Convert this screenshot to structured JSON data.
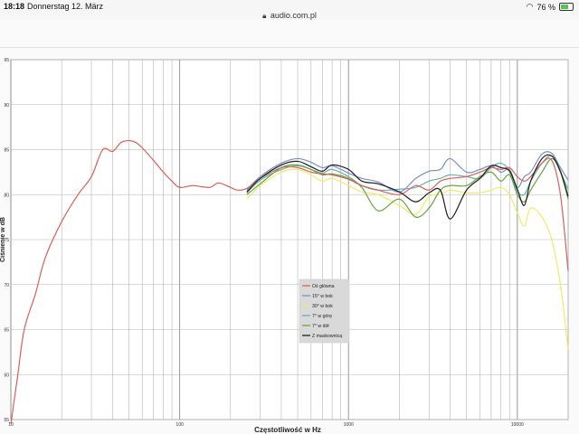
{
  "status_bar": {
    "time": "18:18",
    "date": "Donnerstag 12. März",
    "url": "audio.com.pl",
    "battery": "76 %"
  },
  "icons": [
    "lock-icon",
    "wifi-icon",
    "battery-icon"
  ],
  "chart_data": {
    "type": "line",
    "x_scale": "log",
    "xlim": [
      10,
      20000
    ],
    "ylim": [
      55,
      95
    ],
    "xlabel": "Częstotliwość w Hz",
    "ylabel": "Ciśnienie w dB",
    "x_ticks": [
      {
        "value": 10,
        "label": "10"
      },
      {
        "value": 100,
        "label": "100"
      },
      {
        "value": 1000,
        "label": "1000"
      },
      {
        "value": 10000,
        "label": "10000"
      }
    ],
    "y_ticks": [
      55,
      60,
      65,
      70,
      75,
      80,
      85,
      90,
      95
    ],
    "grid": true,
    "legend_position": "center",
    "series": [
      {
        "name": "Oś główna",
        "color": "#d9605a",
        "x": [
          10,
          11,
          12,
          14,
          16,
          20,
          25,
          30,
          35,
          40,
          45,
          50,
          55,
          60,
          70,
          80,
          90,
          100,
          120,
          150,
          170,
          200,
          220,
          250,
          300,
          400,
          500,
          600,
          700,
          800,
          1000,
          1200,
          1500,
          2000,
          2500,
          3000,
          3500,
          4000,
          5000,
          6000,
          7000,
          8000,
          9000,
          10000,
          11000,
          12000,
          14000,
          16000,
          18000,
          20000
        ],
        "y": [
          54.5,
          60,
          65,
          69,
          73,
          77,
          80,
          82,
          85,
          84.8,
          85.8,
          86,
          85.8,
          85.2,
          83.8,
          82.5,
          81.5,
          80.8,
          81,
          80.8,
          81.3,
          80.8,
          80.5,
          80.7,
          81.8,
          83,
          83,
          82.5,
          82.3,
          82.2,
          81.7,
          81,
          80.5,
          80,
          81,
          80.5,
          81.5,
          81.8,
          82,
          82.5,
          83,
          82.8,
          83,
          82,
          81.5,
          82,
          83.5,
          83.8,
          80,
          71.5
        ]
      },
      {
        "name": "15° w bok",
        "color": "#7b8ec8",
        "x": [
          250,
          300,
          400,
          500,
          600,
          700,
          800,
          1000,
          1200,
          1500,
          2000,
          2500,
          3000,
          3500,
          4000,
          5000,
          6000,
          7000,
          8000,
          9000,
          10000,
          11000,
          12000,
          14000,
          16000,
          18000,
          20000
        ],
        "y": [
          80.5,
          82,
          83.5,
          84,
          83.6,
          83,
          83.2,
          82.4,
          81.8,
          81.4,
          80.3,
          81.8,
          82.6,
          82.8,
          84,
          82.5,
          82.8,
          83.2,
          82.5,
          82.8,
          80.8,
          82,
          82.5,
          84.5,
          84.6,
          83,
          81.6
        ]
      },
      {
        "name": "30° w bok",
        "color": "#f0ea6a",
        "x": [
          250,
          300,
          400,
          500,
          600,
          700,
          800,
          1000,
          1200,
          1500,
          2000,
          2500,
          3000,
          3500,
          4000,
          5000,
          6000,
          7000,
          8000,
          9000,
          10000,
          11000,
          12000,
          14000,
          16000,
          18000,
          20000
        ],
        "y": [
          79.5,
          81,
          82.5,
          82.8,
          82.2,
          81.5,
          81.8,
          81,
          80.3,
          80,
          78.8,
          77.8,
          79.8,
          80,
          80.5,
          80.2,
          80.2,
          80.5,
          80.8,
          80,
          78,
          76.5,
          78.5,
          77.5,
          75,
          70,
          62.8
        ]
      },
      {
        "name": "7° w górę",
        "color": "#66b2a6",
        "x": [
          250,
          300,
          400,
          500,
          600,
          700,
          800,
          1000,
          1200,
          1500,
          2000,
          2500,
          3000,
          3500,
          4000,
          5000,
          6000,
          7000,
          8000,
          9000,
          10000,
          11000,
          12000,
          14000,
          16000,
          18000,
          20000
        ],
        "y": [
          80.2,
          81.6,
          82.8,
          83.2,
          82.8,
          82.4,
          82.8,
          82,
          81,
          80.5,
          80.6,
          80.8,
          81.5,
          81.8,
          82.2,
          82,
          81.8,
          83,
          83.5,
          82.6,
          80.4,
          80,
          81.5,
          83.5,
          84.3,
          82.5,
          80.6
        ]
      },
      {
        "name": "7° w dół",
        "color": "#6aa346",
        "x": [
          250,
          300,
          400,
          500,
          600,
          700,
          800,
          1000,
          1200,
          1500,
          2000,
          2500,
          3000,
          3500,
          4000,
          5000,
          6000,
          7000,
          8000,
          9000,
          10000,
          11000,
          12000,
          14000,
          16000,
          18000,
          20000
        ],
        "y": [
          80,
          81.2,
          83,
          83.3,
          82.8,
          82.2,
          82.3,
          81.8,
          80.8,
          78.2,
          79.5,
          77.5,
          78.5,
          80.5,
          81,
          81,
          82,
          82.5,
          81.5,
          82.2,
          80,
          79.2,
          80.5,
          82.5,
          84,
          82.5,
          79.5
        ]
      },
      {
        "name": "Z maskownicą",
        "color": "#1e1e1e",
        "x": [
          250,
          300,
          400,
          500,
          600,
          700,
          800,
          1000,
          1200,
          1500,
          2000,
          2500,
          3000,
          3500,
          4000,
          5000,
          6000,
          7000,
          8000,
          9000,
          10000,
          11000,
          12000,
          14000,
          16000,
          18000,
          20000
        ],
        "y": [
          80.3,
          81.8,
          83.3,
          83.7,
          83.1,
          82.6,
          83.3,
          82.8,
          81.5,
          81.2,
          80.3,
          79.2,
          80.2,
          80.5,
          77.3,
          80.5,
          81.8,
          83.2,
          83,
          82.6,
          80.6,
          78.8,
          81.5,
          84,
          84.3,
          82.6,
          79.8
        ]
      }
    ]
  }
}
